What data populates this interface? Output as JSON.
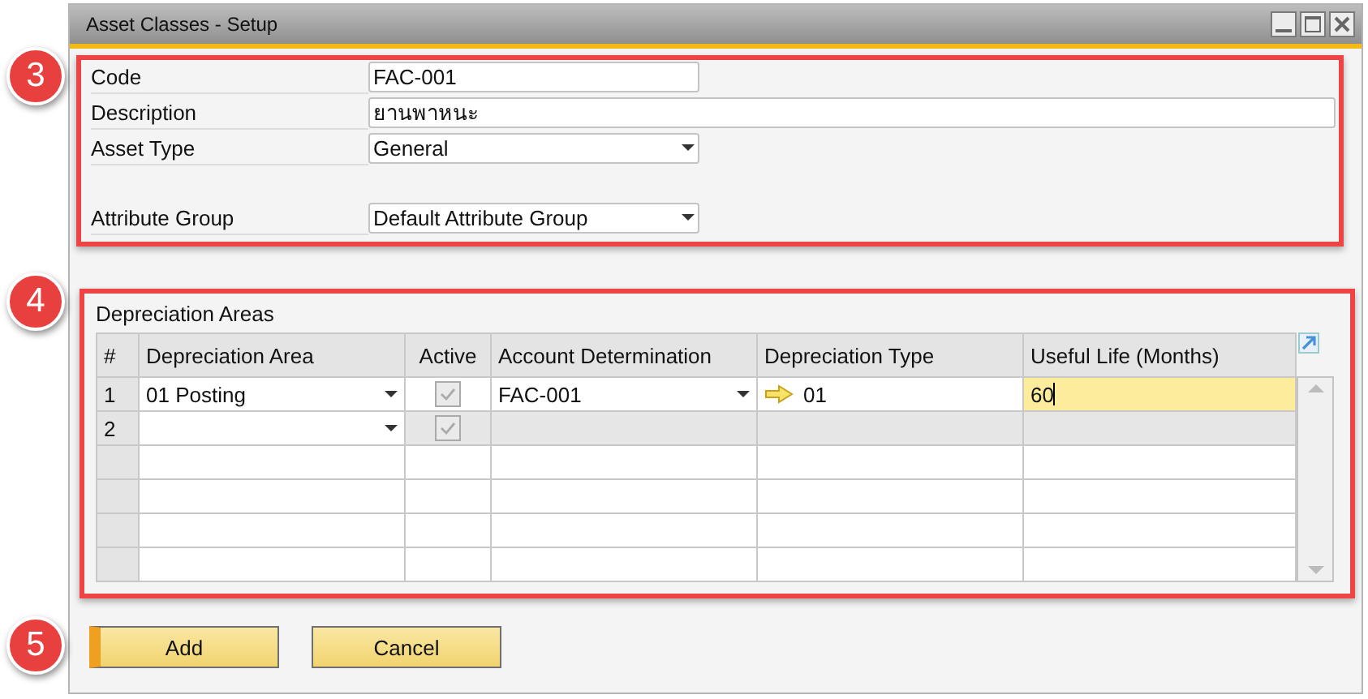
{
  "window": {
    "title": "Asset Classes - Setup"
  },
  "callouts": [
    "3",
    "4",
    "5"
  ],
  "header_fields": [
    {
      "label": "Code",
      "value": "FAC-001",
      "kind": "short"
    },
    {
      "label": "Description",
      "value": "ยานพาหนะ",
      "kind": "long"
    },
    {
      "label": "Asset Type",
      "value": "General",
      "kind": "dropdown"
    },
    {
      "label": "Attribute Group",
      "value": "Default Attribute Group",
      "kind": "dropdown"
    }
  ],
  "depreciation_areas": {
    "title": "Depreciation Areas",
    "columns": [
      "#",
      "Depreciation Area",
      "Active",
      "Account Determination",
      "Depreciation Type",
      "Useful Life (Months)"
    ],
    "rows": [
      {
        "number": "1",
        "area": "01 Posting",
        "active": true,
        "active_disabled": true,
        "account": "FAC-001",
        "type": "01",
        "useful_life": "60",
        "kind": "entry",
        "editing": true
      },
      {
        "number": "2",
        "active": true,
        "active_disabled": true,
        "kind": "new",
        "editing": false
      }
    ]
  },
  "buttons": [
    {
      "label": "Add",
      "default": true
    },
    {
      "label": "Cancel",
      "default": false
    }
  ]
}
